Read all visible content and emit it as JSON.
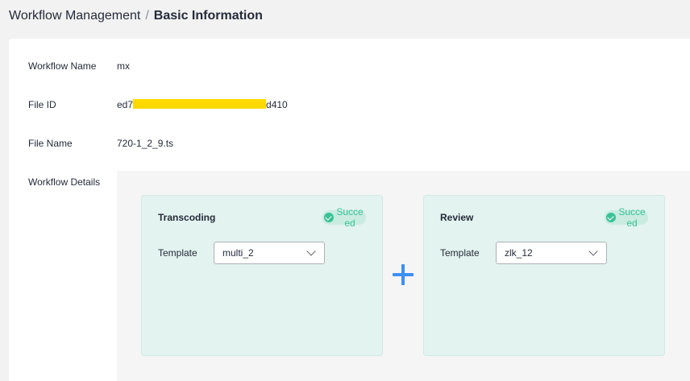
{
  "breadcrumb": {
    "parent": "Workflow Management",
    "separator": "/",
    "current": "Basic Information"
  },
  "info": {
    "workflow_name_label": "Workflow Name",
    "workflow_name_value": "mx",
    "file_id_label": "File ID",
    "file_id_prefix": "ed7",
    "file_id_suffix": "d410",
    "file_name_label": "File Name",
    "file_name_value": "720-1_2_9.ts",
    "workflow_details_label": "Workflow Details"
  },
  "nodes": [
    {
      "title": "Transcoding",
      "status": "Succeed",
      "template_label": "Template",
      "template_value": "multi_2"
    },
    {
      "title": "Review",
      "status": "Succeed",
      "template_label": "Template",
      "template_value": "zlk_12"
    }
  ],
  "colors": {
    "accent_blue": "#3e8ff5",
    "success_green": "#3ac295",
    "card_bg": "#e3f3ef",
    "redaction": "#ffd900"
  },
  "icons": {
    "connector": "plus-icon",
    "status": "check-circle-icon",
    "dropdown": "chevron-down-icon"
  }
}
